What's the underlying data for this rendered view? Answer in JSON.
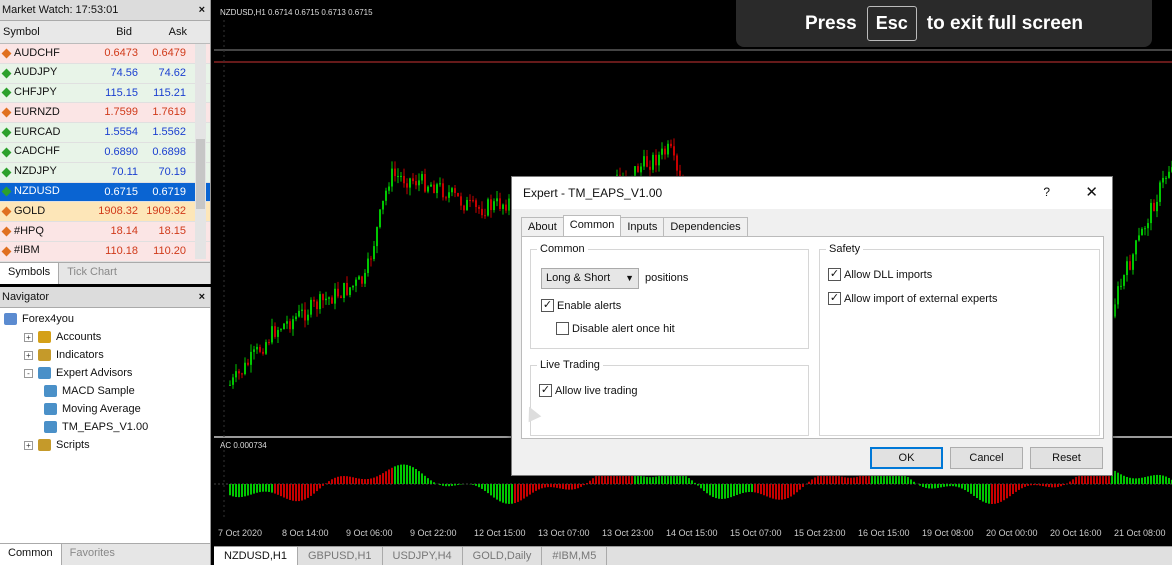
{
  "market_watch": {
    "title": "Market Watch: 17:53:01",
    "close": "×",
    "col_symbol": "Symbol",
    "col_bid": "Bid",
    "col_ask": "Ask",
    "rows": [
      {
        "symbol": "AUDCHF",
        "bid": "0.6473",
        "ask": "0.6479",
        "dir": "down"
      },
      {
        "symbol": "AUDJPY",
        "bid": "74.56",
        "ask": "74.62",
        "dir": "up"
      },
      {
        "symbol": "CHFJPY",
        "bid": "115.15",
        "ask": "115.21",
        "dir": "up"
      },
      {
        "symbol": "EURNZD",
        "bid": "1.7599",
        "ask": "1.7619",
        "dir": "down"
      },
      {
        "symbol": "EURCAD",
        "bid": "1.5554",
        "ask": "1.5562",
        "dir": "up"
      },
      {
        "symbol": "CADCHF",
        "bid": "0.6890",
        "ask": "0.6898",
        "dir": "up"
      },
      {
        "symbol": "NZDJPY",
        "bid": "70.11",
        "ask": "70.19",
        "dir": "up"
      },
      {
        "symbol": "NZDUSD",
        "bid": "0.6715",
        "ask": "0.6719",
        "dir": "up",
        "selected": true
      },
      {
        "symbol": "GOLD",
        "bid": "1908.32",
        "ask": "1909.32",
        "dir": "down"
      },
      {
        "symbol": "#HPQ",
        "bid": "18.14",
        "ask": "18.15",
        "dir": "down"
      },
      {
        "symbol": "#IBM",
        "bid": "110.18",
        "ask": "110.20",
        "dir": "down"
      }
    ],
    "tabs": [
      "Symbols",
      "Tick Chart"
    ]
  },
  "navigator": {
    "title": "Navigator",
    "close": "×",
    "items": [
      {
        "label": "Forex4you",
        "level": 0,
        "icon": "account-icon",
        "color": "#5b8bd0"
      },
      {
        "label": "Accounts",
        "level": 1,
        "icon": "folder-icon",
        "color": "#d4a017",
        "expander": "+"
      },
      {
        "label": "Indicators",
        "level": 1,
        "icon": "indicator-icon",
        "color": "#c59a2a",
        "expander": "+"
      },
      {
        "label": "Expert Advisors",
        "level": 1,
        "icon": "expert-icon",
        "color": "#4a90c8",
        "expander": "-"
      },
      {
        "label": "MACD Sample",
        "level": 2,
        "icon": "ea-icon",
        "color": "#4a90c8"
      },
      {
        "label": "Moving Average",
        "level": 2,
        "icon": "ea-icon",
        "color": "#4a90c8"
      },
      {
        "label": "TM_EAPS_V1.00",
        "level": 2,
        "icon": "ea-icon",
        "color": "#4a90c8"
      },
      {
        "label": "Scripts",
        "level": 1,
        "icon": "script-icon",
        "color": "#c59a2a",
        "expander": "+"
      }
    ],
    "tabs": [
      "Common",
      "Favorites"
    ]
  },
  "chart": {
    "caption": "NZDUSD,H1  0.6714 0.6715 0.6713 0.6715",
    "indicator_caption": "AC 0.000734",
    "x_labels": [
      "7 Oct 2020",
      "8 Oct 14:00",
      "9 Oct 06:00",
      "9 Oct 22:00",
      "12 Oct 15:00",
      "13 Oct 07:00",
      "13 Oct 23:00",
      "14 Oct 15:00",
      "15 Oct 07:00",
      "15 Oct 23:00",
      "16 Oct 15:00",
      "19 Oct 08:00",
      "20 Oct 00:00",
      "20 Oct 16:00",
      "21 Oct 08:00"
    ],
    "tabs": [
      "NZDUSD,H1",
      "GBPUSD,H1",
      "USDJPY,H4",
      "GOLD,Daily",
      "#IBM,M5"
    ],
    "up_color": "#00c800",
    "down_color": "#c80000"
  },
  "fullscreen": {
    "press": "Press",
    "key": "Esc",
    "message": "to exit full screen"
  },
  "dialog": {
    "title": "Expert - TM_EAPS_V1.00",
    "help": "?",
    "close": "✕",
    "tabs": [
      "About",
      "Common",
      "Inputs",
      "Dependencies"
    ],
    "common_group": "Common",
    "positions_value": "Long & Short",
    "positions_label": "positions",
    "enable_alerts": "Enable alerts",
    "disable_alert_once_hit": "Disable alert once hit",
    "live_trading_group": "Live Trading",
    "allow_live_trading": "Allow live trading",
    "safety_group": "Safety",
    "allow_dll_imports": "Allow DLL imports",
    "allow_external_experts": "Allow import of external experts",
    "ok": "OK",
    "cancel": "Cancel",
    "reset": "Reset"
  }
}
